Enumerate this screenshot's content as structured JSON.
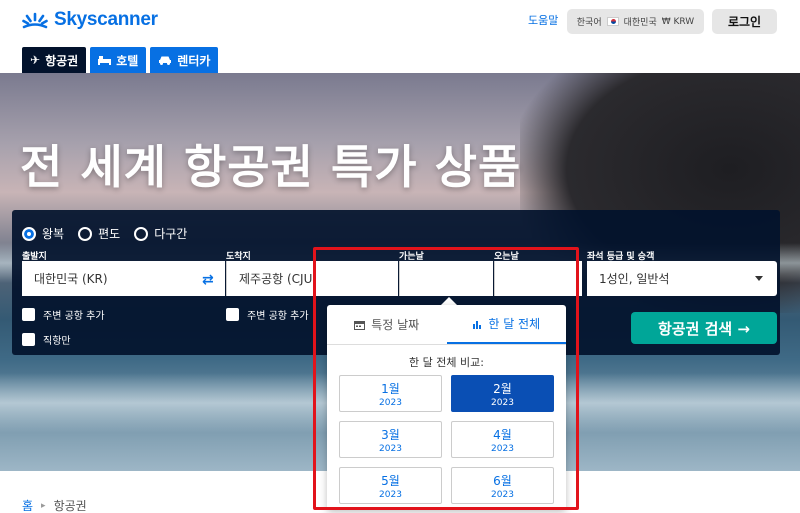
{
  "header": {
    "logo": "Skyscanner",
    "help": "도움말",
    "locale": {
      "language": "한국어",
      "country": "대한민국",
      "currency": "₩ KRW"
    },
    "login": "로그인"
  },
  "tabs": [
    {
      "label": "항공권",
      "icon": "plane-icon"
    },
    {
      "label": "호텔",
      "icon": "bed-icon"
    },
    {
      "label": "렌터카",
      "icon": "car-icon"
    }
  ],
  "hero": {
    "title": "전 세계 항공권 특가 상품"
  },
  "search": {
    "trip_types": [
      "왕복",
      "편도",
      "다구간"
    ],
    "from_label": "출발지",
    "from_value": "대한민국 (KR)",
    "to_label": "도착지",
    "to_value": "제주공항 (CJU",
    "depart_label": "가는날",
    "return_label": "오는날",
    "cabin_label": "좌석 등급 및 승객",
    "cabin_value": "1성인, 일반석",
    "nearby_from": "주변 공항 추가",
    "nearby_to": "주변 공항 추가",
    "direct_only": "직항만",
    "submit": "항공권 검색 →"
  },
  "date_popover": {
    "tab_specific": "특정 날짜",
    "tab_month": "한 달 전체",
    "subtitle": "한 달 전체 비교:",
    "months": [
      {
        "month": "1월",
        "year": "2023"
      },
      {
        "month": "2월",
        "year": "2023"
      },
      {
        "month": "3월",
        "year": "2023"
      },
      {
        "month": "4월",
        "year": "2023"
      },
      {
        "month": "5월",
        "year": "2023"
      },
      {
        "month": "6월",
        "year": "2023"
      }
    ]
  },
  "breadcrumb": {
    "home": "홈",
    "current": "항공권"
  },
  "colors": {
    "brand": "#0770e3",
    "navy": "#02122c",
    "cta": "#00a698",
    "highlight": "#e2131b"
  }
}
